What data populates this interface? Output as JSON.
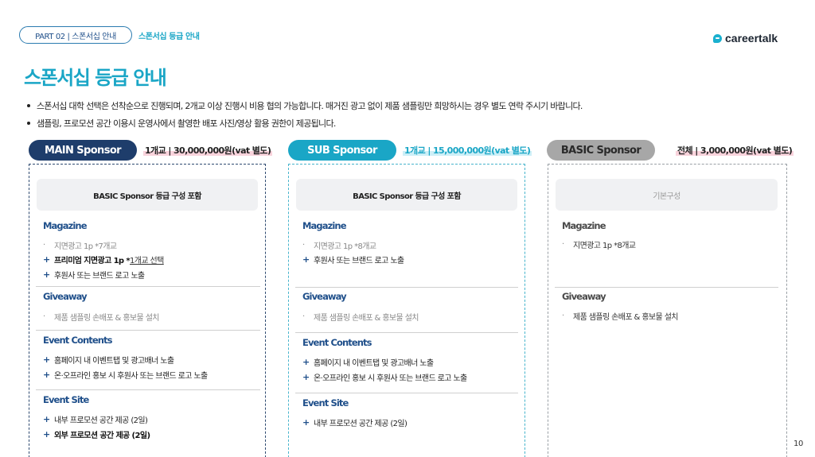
{
  "header": {
    "breadcrumb_pill": "PART 02 | 스폰서십 안내",
    "breadcrumb_current": "스폰서십 등급 안내",
    "logo_text": "careertalk",
    "logo_icon": "chat-bubble-icon"
  },
  "title": "스폰서십 등급 안내",
  "bullets": [
    "스폰서십 대학 선택은 선착순으로 진행되며, 2개교 이상 진행시 비용 협의 가능합니다. 매거진 광고 없이 제품 샘플링만 희망하시는 경우 별도 연락 주시기 바랍니다.",
    "샘플링, 프로모션 공간 이용시 운영사에서 촬영한 배포 사진/영상 활용 권한이 제공됩니다."
  ],
  "tiers": {
    "main": {
      "name": "MAIN Sponsor",
      "price": "1개교 | 30,000,000원(vat 별도)",
      "color": "#1e3d6b",
      "include": "BASIC Sponsor 등급 구성 포함",
      "magazine": {
        "title": "Magazine",
        "items": [
          "지면광고 1p *7개교",
          "프리미엄 지면광고 1p *",
          "1개교 선택",
          "후원사 또는 브랜드 로고 노출"
        ]
      },
      "giveaway": {
        "title": "Giveaway",
        "items": [
          "제품 샘플링 손배포 & 홍보물 설치"
        ]
      },
      "event_contents": {
        "title": "Event Contents",
        "items": [
          "홈페이지 내 이벤트탭 및 광고배너 노출",
          "온·오프라인 홍보 시 후원사 또는 브랜드 로고 노출"
        ]
      },
      "event_site": {
        "title": "Event Site",
        "items": [
          "내부 프로모션 공간 제공 (2일)",
          "외부 프로모션 공간 제공 (2일)"
        ]
      }
    },
    "sub": {
      "name": "SUB Sponsor",
      "price": "1개교 | 15,000,000원(vat 별도)",
      "color": "#1aa6c6",
      "include": "BASIC Sponsor 등급 구성 포함",
      "magazine": {
        "title": "Magazine",
        "items": [
          "지면광고 1p *8개교",
          "후원사 또는 브랜드 로고 노출"
        ]
      },
      "giveaway": {
        "title": "Giveaway",
        "items": [
          "제품 샘플링 손배포 & 홍보물 설치"
        ]
      },
      "event_contents": {
        "title": "Event Contents",
        "items": [
          "홈페이지 내 이벤트탭 및 광고배너 노출",
          "온·오프라인 홍보 시 후원사 또는 브랜드 로고 노출"
        ]
      },
      "event_site": {
        "title": "Event Site",
        "items": [
          "내부 프로모션 공간 제공 (2일)"
        ]
      }
    },
    "basic": {
      "name": "BASIC Sponsor",
      "price": "전체 | 3,000,000원(vat 별도)",
      "color": "#a7a7a7",
      "include": "기본구성",
      "magazine": {
        "title": "Magazine",
        "items": [
          "지면광고 1p *8개교"
        ]
      },
      "giveaway": {
        "title": "Giveaway",
        "items": [
          "제품 샘플링 손배포 & 홍보물 설치"
        ]
      }
    }
  },
  "page_number": "10"
}
